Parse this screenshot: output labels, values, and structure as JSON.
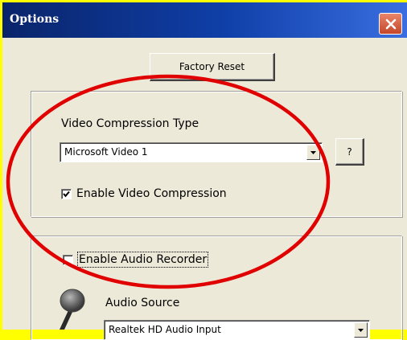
{
  "window": {
    "title": "Options"
  },
  "buttons": {
    "factory_reset": "Factory Reset",
    "help": "?"
  },
  "video": {
    "compression_type_label": "Video Compression Type",
    "compression_selected": "Microsoft Video 1",
    "enable_compression_label": "Enable Video Compression",
    "enable_compression_checked": true
  },
  "audio": {
    "enable_recorder_label": "Enable Audio Recorder",
    "enable_recorder_checked": false,
    "source_label": "Audio Source",
    "source_selected": "Realtek HD Audio Input"
  },
  "icons": {
    "close": "close-icon",
    "dropdown": "chevron-down-icon",
    "checkmark": "checkmark-icon",
    "microphone": "microphone-icon"
  },
  "colors": {
    "background_border": "#ffff00",
    "dialog_face": "#ece9d8",
    "title_bar": "#0a246a",
    "close_button": "#c4462a",
    "annotation": "#e00000"
  }
}
